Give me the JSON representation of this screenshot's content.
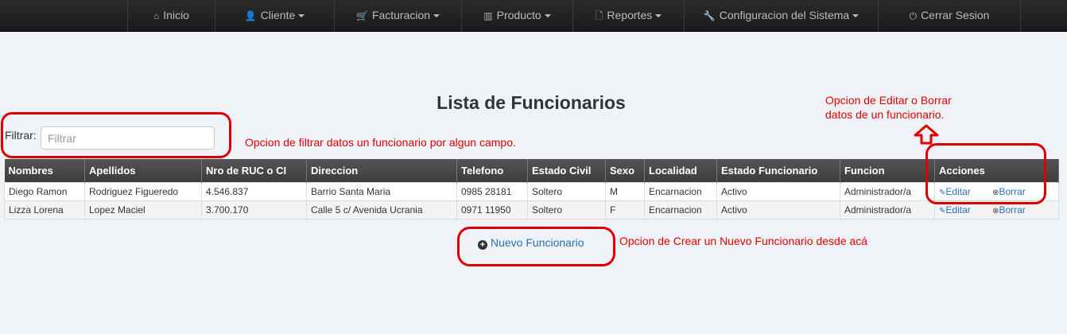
{
  "nav": {
    "items": [
      {
        "label": "Inicio",
        "icon": "home-icon",
        "glyph": "⌂",
        "dropdown": false
      },
      {
        "label": "Cliente",
        "icon": "user-icon",
        "glyph": "👤",
        "dropdown": true
      },
      {
        "label": "Facturacion",
        "icon": "cart-icon",
        "glyph": "🛒",
        "dropdown": true
      },
      {
        "label": "Producto",
        "icon": "barcode-icon",
        "glyph": "▥",
        "dropdown": true
      },
      {
        "label": "Reportes",
        "icon": "file-icon",
        "glyph": "🗋",
        "dropdown": true
      },
      {
        "label": "Configuracion del Sistema",
        "icon": "wrench-icon",
        "glyph": "🔧",
        "dropdown": true
      },
      {
        "label": "Cerrar Sesion",
        "icon": "power-icon",
        "glyph": "⏻",
        "dropdown": false
      }
    ]
  },
  "page": {
    "title": "Lista de Funcionarios"
  },
  "filter": {
    "label": "Filtrar:",
    "placeholder": "Filtrar"
  },
  "table": {
    "headers": [
      "Nombres",
      "Apellidos",
      "Nro de RUC o CI",
      "Direccion",
      "Telefono",
      "Estado Civil",
      "Sexo",
      "Localidad",
      "Estado Funcionario",
      "Funcion",
      "Acciones"
    ],
    "rows": [
      [
        "Diego Ramon",
        "Rodriguez Figueredo",
        "4.546.837",
        "Barrio Santa Maria",
        "0985 28181",
        "Soltero",
        "M",
        "Encarnacion",
        "Activo",
        "Administrador/a"
      ],
      [
        "Lizza Lorena",
        "Lopez Maciel",
        "3.700.170",
        "Calle 5 c/ Avenida Ucrania",
        "0971 11950",
        "Soltero",
        "F",
        "Encarnacion",
        "Activo",
        "Administrador/a"
      ]
    ],
    "edit_label": "Editar",
    "delete_label": "Borrar"
  },
  "new_link": {
    "label": "Nuevo Funcionario"
  },
  "annotations": {
    "filter_note": "Opcion de filtrar datos un funcionario por algun campo.",
    "edit_note_line1": "Opcion de Editar o Borrar",
    "edit_note_line2": "datos de un funcionario.",
    "create_note": "Opcion de Crear un Nuevo Funcionario desde acá"
  },
  "colors": {
    "annotation": "#e00000",
    "link": "#2a6fb5",
    "navbar": "#222222"
  }
}
